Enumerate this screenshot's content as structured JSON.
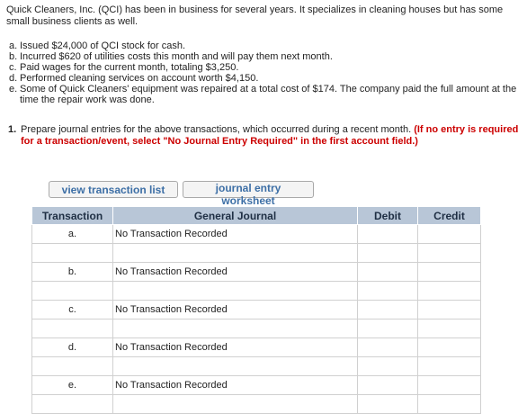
{
  "problem": {
    "intro": "Quick Cleaners, Inc. (QCI) has been in business for several years. It specializes in cleaning houses but has some small business clients as well.",
    "transactions": [
      {
        "letter": "a.",
        "text": "Issued $24,000 of QCI stock for cash."
      },
      {
        "letter": "b.",
        "text": "Incurred $620 of utilities costs this month and will pay them next month."
      },
      {
        "letter": "c.",
        "text": "Paid wages for the current month, totaling $3,250."
      },
      {
        "letter": "d.",
        "text": "Performed cleaning services on account worth $4,150."
      },
      {
        "letter": "e.",
        "text": "Some of Quick Cleaners' equipment was repaired at a total cost of $174. The company paid the full amount at the time the repair work was done."
      }
    ]
  },
  "question": {
    "number": "1.",
    "text": "Prepare journal entries for the above transactions, which occurred during a recent month.",
    "instruction": "(If no entry is required for a transaction/event, select \"No Journal Entry Required\" in the first account field.)"
  },
  "buttons": {
    "view_transaction_list": "view transaction list",
    "journal_entry_worksheet": "journal entry worksheet"
  },
  "journal_table": {
    "headers": {
      "transaction": "Transaction",
      "general_journal": "General Journal",
      "debit": "Debit",
      "credit": "Credit"
    },
    "rows": [
      {
        "transaction": "a.",
        "account": "No Transaction Recorded",
        "debit": "",
        "credit": ""
      },
      {
        "transaction": "",
        "account": "",
        "debit": "",
        "credit": ""
      },
      {
        "transaction": "b.",
        "account": "No Transaction Recorded",
        "debit": "",
        "credit": ""
      },
      {
        "transaction": "",
        "account": "",
        "debit": "",
        "credit": ""
      },
      {
        "transaction": "c.",
        "account": "No Transaction Recorded",
        "debit": "",
        "credit": ""
      },
      {
        "transaction": "",
        "account": "",
        "debit": "",
        "credit": ""
      },
      {
        "transaction": "d.",
        "account": "No Transaction Recorded",
        "debit": "",
        "credit": ""
      },
      {
        "transaction": "",
        "account": "",
        "debit": "",
        "credit": ""
      },
      {
        "transaction": "e.",
        "account": "No Transaction Recorded",
        "debit": "",
        "credit": ""
      },
      {
        "transaction": "",
        "account": "",
        "debit": "",
        "credit": ""
      }
    ]
  }
}
